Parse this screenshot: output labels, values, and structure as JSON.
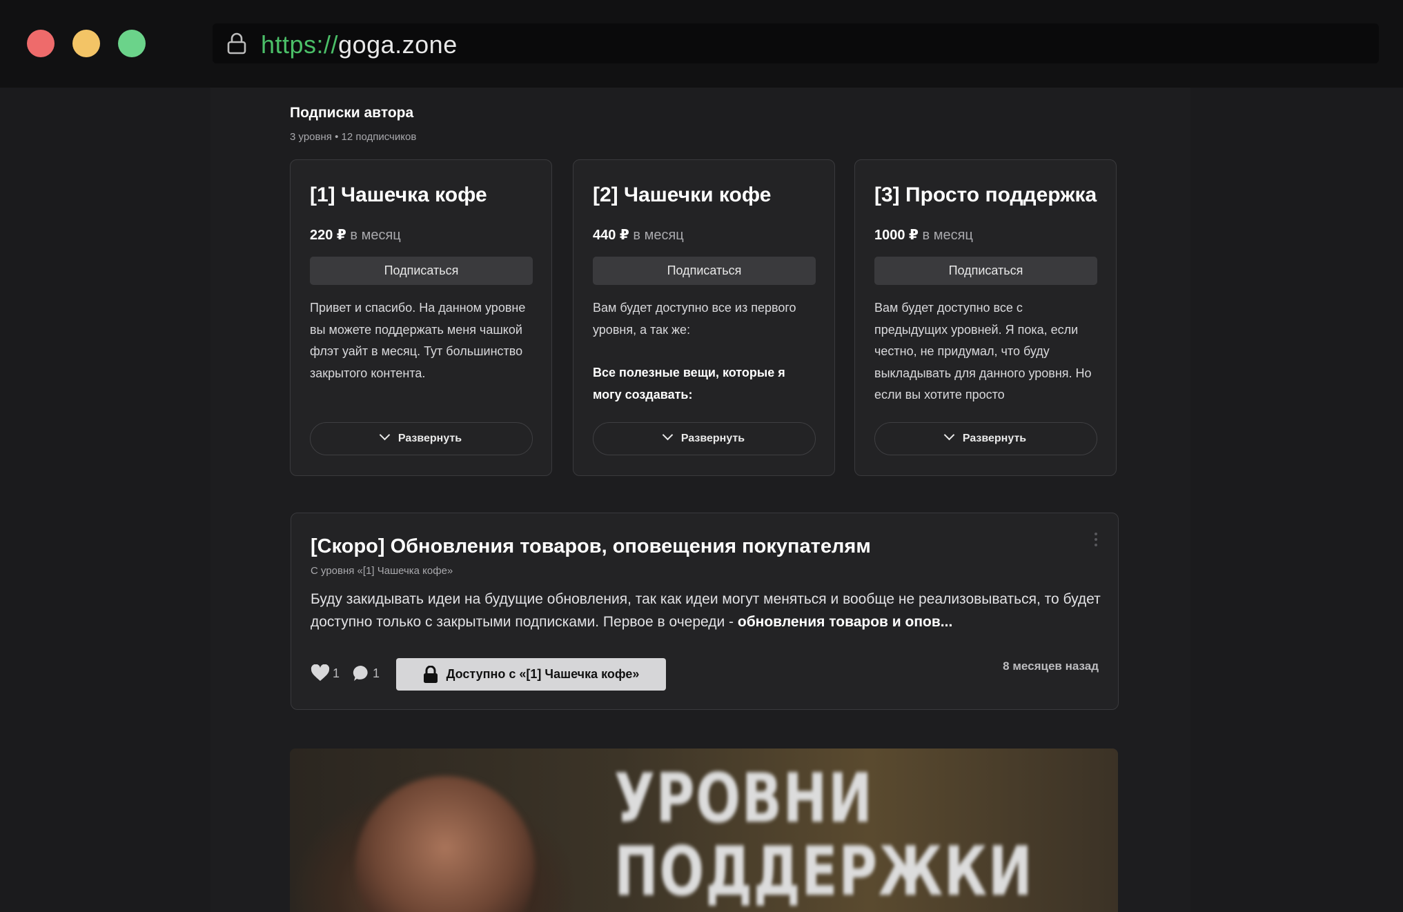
{
  "browser": {
    "url_scheme": "https://",
    "url_host": "goga.zone",
    "window_buttons": [
      "close",
      "minimize",
      "maximize"
    ],
    "colors": {
      "close": "#ee6b6b",
      "minimize": "#f3c466",
      "maximize": "#6bd38a",
      "scheme": "#4bbf68"
    }
  },
  "subscriptions": {
    "title": "Подписки автора",
    "subtitle": "3 уровня • 12 подписчиков",
    "tiers": [
      {
        "title": "[1] Чашечка кофе",
        "price": "220 ₽",
        "period": "в месяц",
        "subscribe_label": "Подписаться",
        "description": "Привет и спасибо. На данном уровне вы можете поддержать меня чашкой флэт уайт в месяц. Тут большинство закрытого контента.",
        "expand_label": "Развернуть"
      },
      {
        "title": "[2] Чашечки кофе",
        "price": "440 ₽",
        "period": "в месяц",
        "subscribe_label": "Подписаться",
        "description": "Вам будет доступно все из первого уровня, а так же:",
        "description_bold": "Все полезные вещи, которые я могу создавать:",
        "expand_label": "Развернуть"
      },
      {
        "title": "[3] Просто поддержка",
        "price": "1000 ₽",
        "period": "в месяц",
        "subscribe_label": "Подписаться",
        "description": "Вам будет доступно все с предыдущих уровней. Я пока, если честно, не придумал, что буду выкладывать для данного уровня. Но если вы хотите просто",
        "expand_label": "Развернуть"
      }
    ]
  },
  "post": {
    "title": "[Скоро] Обновления товаров, оповещения покупателям",
    "tier_note": "С уровня «[1] Чашечка кофе»",
    "body": "Буду закидывать идеи на будущие обновления, так как идеи могут меняться и вообще не реализовываться, то будет доступно только с закрытыми подписками. Первое в очереди - ",
    "body_bold": "обновления товаров и опов...",
    "likes": "1",
    "comments": "1",
    "access_label": "Доступно с «[1] Чашечка кофе»",
    "time": "8 месяцев назад"
  },
  "banner": {
    "line1": "УРОВНИ",
    "line2": "ПОДДЕРЖКИ"
  }
}
